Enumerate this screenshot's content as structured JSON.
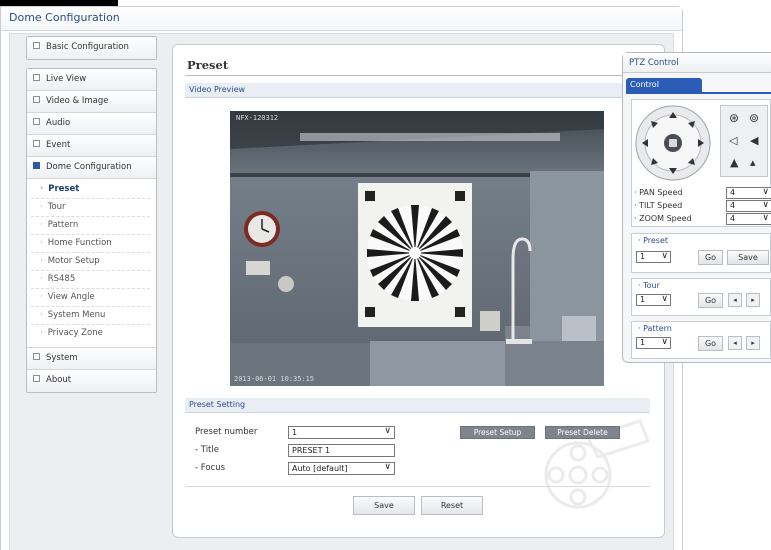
{
  "app": {
    "title": "Dome Configuration"
  },
  "sidebar": {
    "items_top": [
      {
        "label": "Basic Configuration"
      }
    ],
    "items": [
      {
        "label": "Live View"
      },
      {
        "label": "Video & Image"
      },
      {
        "label": "Audio"
      },
      {
        "label": "Event"
      },
      {
        "label": "Dome Configuration"
      }
    ],
    "sub_items": [
      {
        "label": "Preset"
      },
      {
        "label": "Tour"
      },
      {
        "label": "Pattern"
      },
      {
        "label": "Home Function"
      },
      {
        "label": "Motor Setup"
      },
      {
        "label": "RS485"
      },
      {
        "label": "View Angle"
      },
      {
        "label": "System Menu"
      },
      {
        "label": "Privacy Zone"
      }
    ],
    "items_bottom": [
      {
        "label": "System"
      },
      {
        "label": "About"
      }
    ]
  },
  "main": {
    "title": "Preset",
    "video_section": "Video Preview",
    "video_overlay_top": "NFX-120312",
    "video_overlay_bottom": "2013-06-01 10:35:15",
    "preset_section": "Preset Setting",
    "preset_number_label": "Preset number",
    "preset_number_value": "1",
    "title_label": "- Title",
    "title_value": "PRESET 1",
    "focus_label": "- Focus",
    "focus_value": "Auto  [default]",
    "preset_setup_label": "Preset Setup",
    "preset_delete_label": "Preset Delete",
    "save_label": "Save",
    "reset_label": "Reset"
  },
  "ptz": {
    "title": "PTZ Control",
    "tab": "Control",
    "pan_label": "· PAN Speed",
    "pan_value": "4",
    "tilt_label": "· TILT Speed",
    "tilt_value": "4",
    "zoom_label": "· ZOOM Speed",
    "zoom_value": "4",
    "preset_label": "· Preset",
    "preset_value": "1",
    "go_label": "Go",
    "save_label": "Save",
    "tour_label": "· Tour",
    "tour_value": "1",
    "pattern_label": "· Pattern",
    "pattern_value": "1"
  },
  "colors": {
    "accent": "#2a5cb8",
    "title_text": "#2b4e8c",
    "gray_button": "#7f858d"
  }
}
